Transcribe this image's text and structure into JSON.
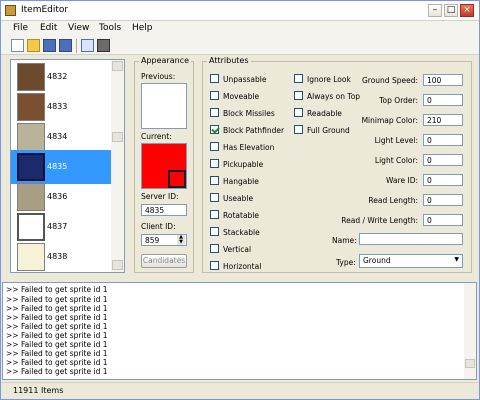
{
  "window": {
    "title": "ItemEditor"
  },
  "menu": {
    "items": [
      "File",
      "Edit",
      "View",
      "Tools",
      "Help"
    ]
  },
  "toolbar": {
    "icons": [
      "new-icon",
      "open-icon",
      "save-icon",
      "save-as-icon",
      "window-icon",
      "tool-icon"
    ]
  },
  "item_list": {
    "items": [
      {
        "id": "4832",
        "selected": false
      },
      {
        "id": "4833",
        "selected": false
      },
      {
        "id": "4834",
        "selected": false
      },
      {
        "id": "4835",
        "selected": true
      },
      {
        "id": "4836",
        "selected": false
      },
      {
        "id": "4837",
        "selected": false
      },
      {
        "id": "4838",
        "selected": false
      }
    ]
  },
  "appearance": {
    "title": "Appearance",
    "previous_label": "Previous:",
    "current_label": "Current:",
    "server_id_label": "Server ID:",
    "server_id": "4835",
    "client_id_label": "Client ID:",
    "client_id": "859",
    "candidates_label": "Candidates",
    "current_color": "#ff0000"
  },
  "attributes": {
    "title": "Attributes",
    "col1": [
      {
        "label": "Unpassable",
        "checked": false
      },
      {
        "label": "Moveable",
        "checked": false
      },
      {
        "label": "Block Missiles",
        "checked": false
      },
      {
        "label": "Block Pathfinder",
        "checked": true
      },
      {
        "label": "Has Elevation",
        "checked": false
      },
      {
        "label": "Pickupable",
        "checked": false
      },
      {
        "label": "Hangable",
        "checked": false
      },
      {
        "label": "Useable",
        "checked": false
      },
      {
        "label": "Rotatable",
        "checked": false
      },
      {
        "label": "Stackable",
        "checked": false
      },
      {
        "label": "Vertical",
        "checked": false
      },
      {
        "label": "Horizontal",
        "checked": false
      }
    ],
    "col2": [
      {
        "label": "Ignore Look",
        "checked": false
      },
      {
        "label": "Always on Top",
        "checked": false
      },
      {
        "label": "Readable",
        "checked": false
      },
      {
        "label": "Full Ground",
        "checked": false
      }
    ],
    "fields": [
      {
        "label": "Ground Speed:",
        "value": "100"
      },
      {
        "label": "Top Order:",
        "value": "0"
      },
      {
        "label": "Minimap Color:",
        "value": "210"
      },
      {
        "label": "Light Level:",
        "value": "0"
      },
      {
        "label": "Light Color:",
        "value": "0"
      },
      {
        "label": "Ware ID:",
        "value": "0"
      },
      {
        "label": "Read Length:",
        "value": "0"
      },
      {
        "label": "Read / Write Length:",
        "value": "0"
      }
    ],
    "name_label": "Name:",
    "name_value": "",
    "type_label": "Type:",
    "type_value": "Ground"
  },
  "output": {
    "lines": [
      ">> Failed to get sprite id 1",
      ">> Failed to get sprite id 1",
      ">> Failed to get sprite id 1",
      ">> Failed to get sprite id 1",
      ">> Failed to get sprite id 1",
      ">> Failed to get sprite id 1",
      ">> Failed to get sprite id 1",
      ">> Failed to get sprite id 1",
      ">> Failed to get sprite id 1",
      ">> Failed to get sprite id 1",
      ">> Failed to get sprite id 1"
    ]
  },
  "status": {
    "count": "11911 Items"
  }
}
